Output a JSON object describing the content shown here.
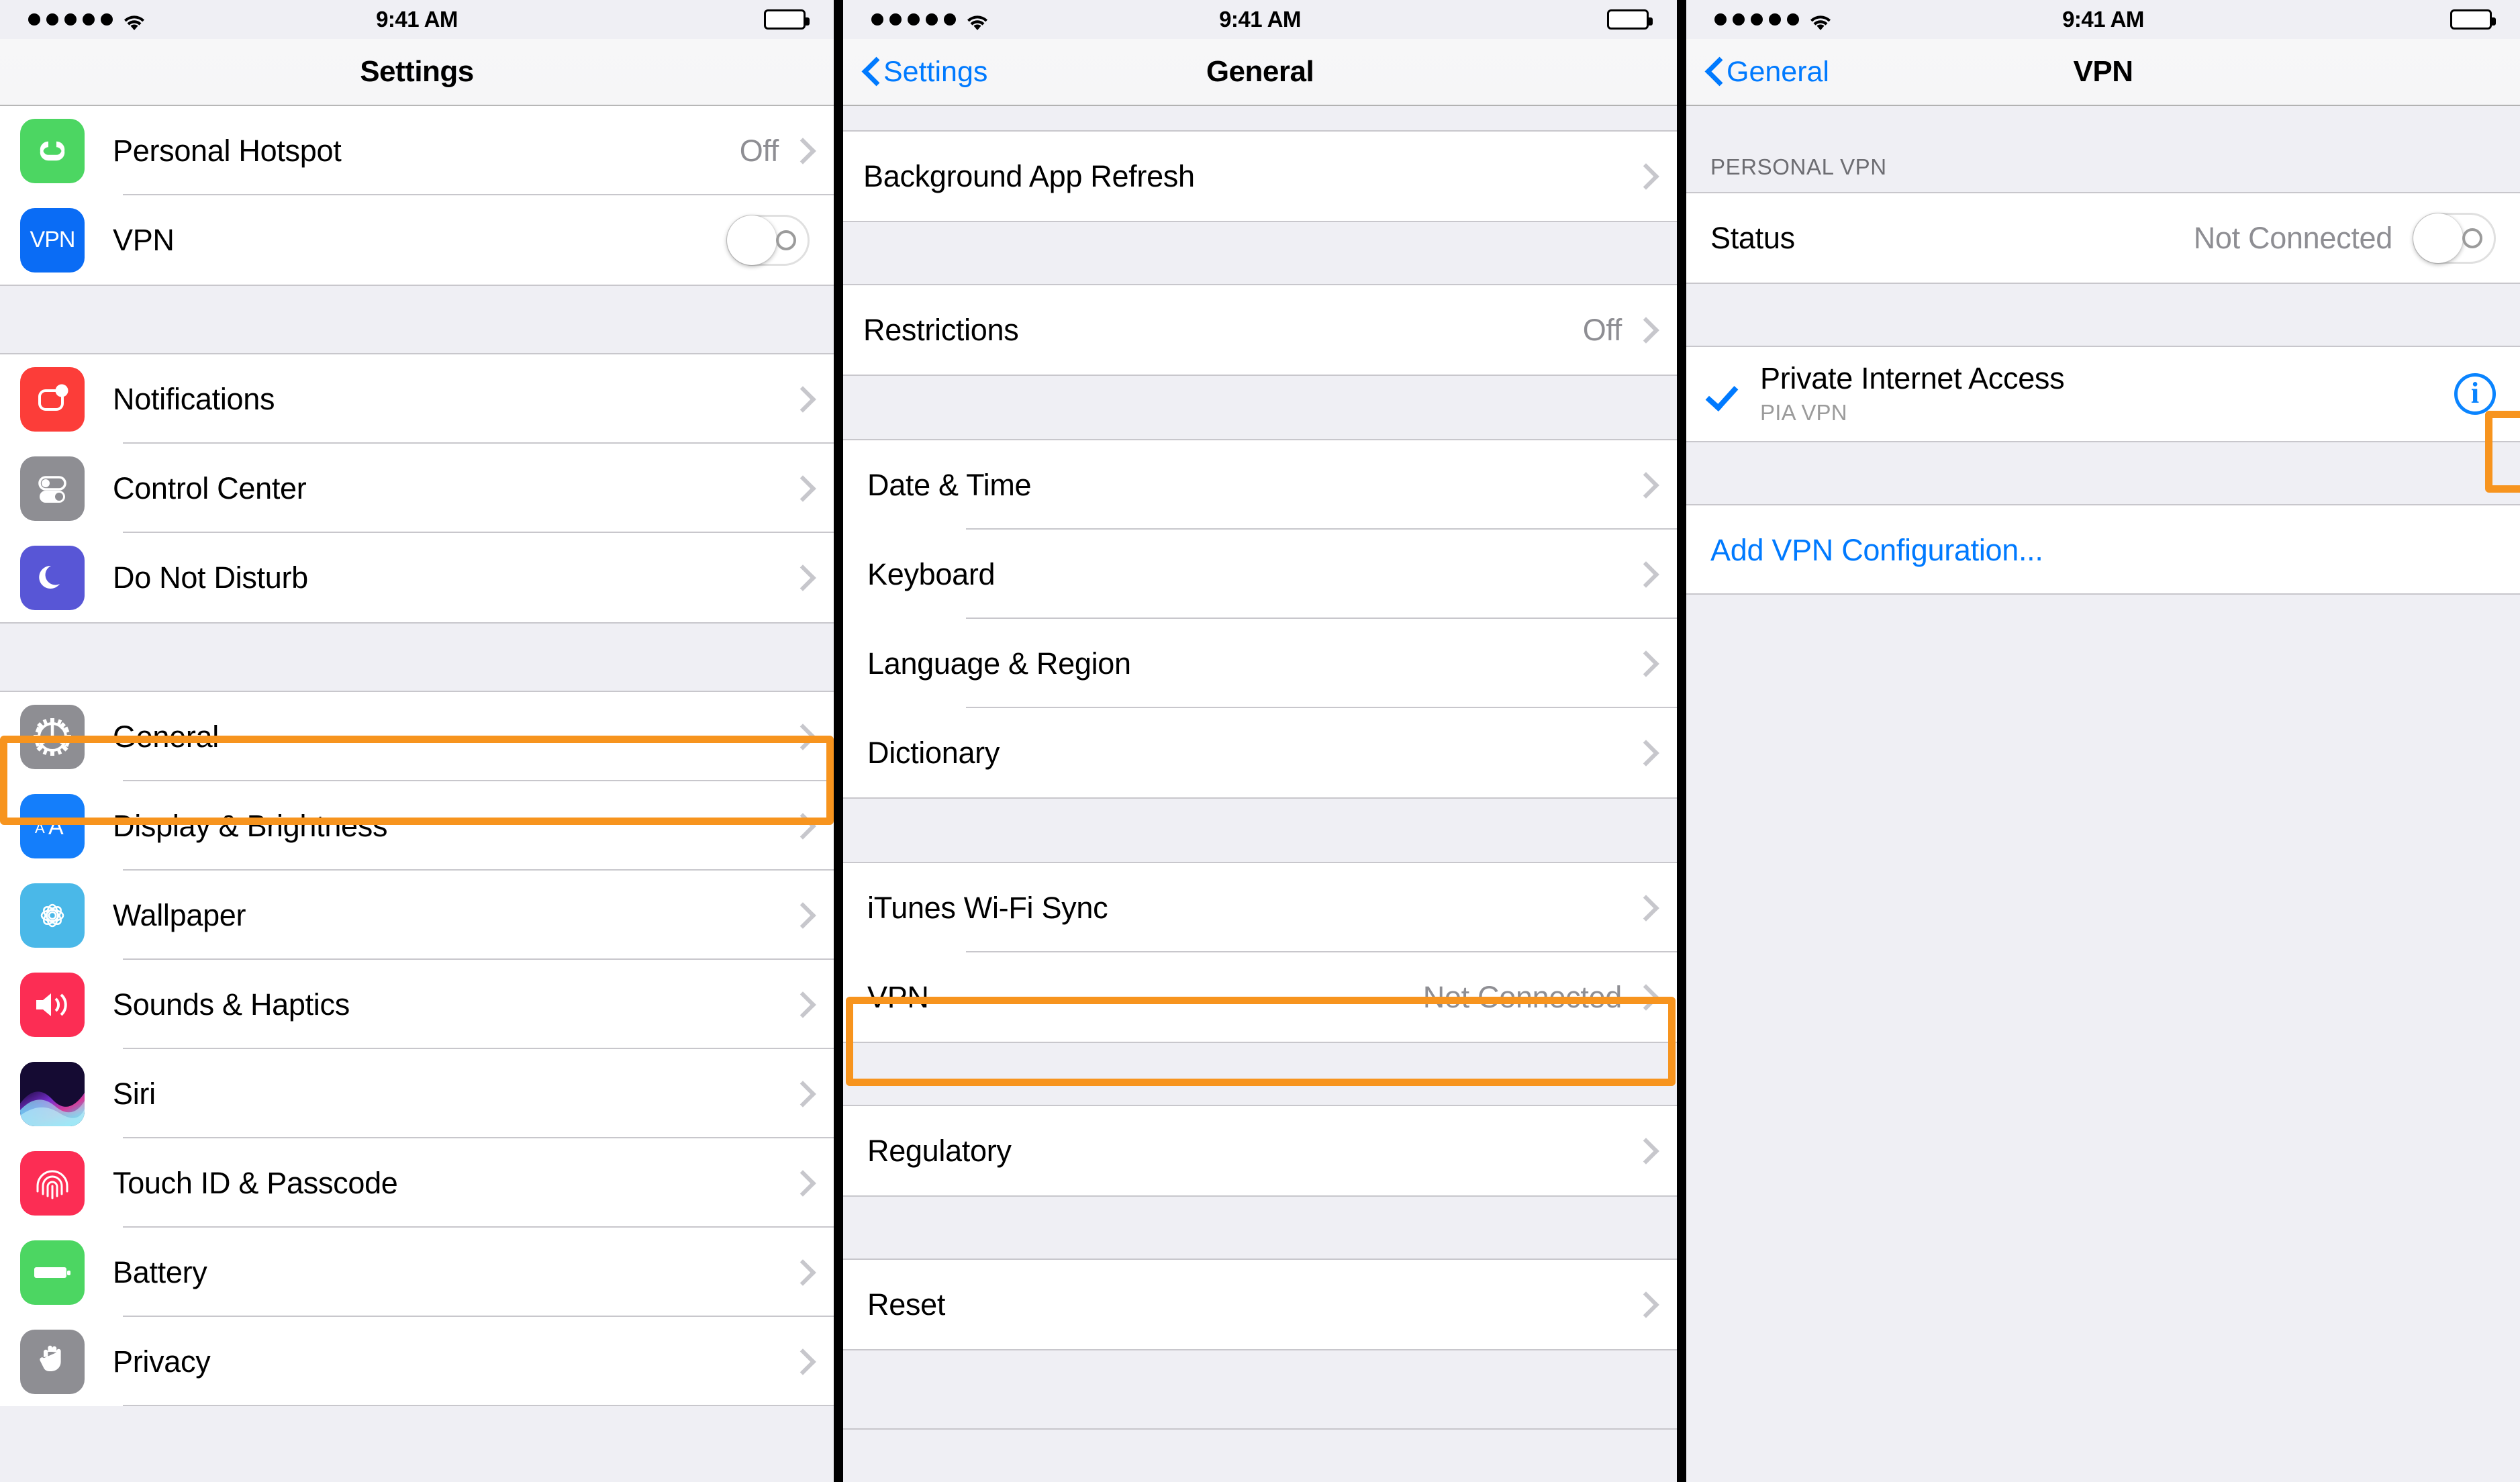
{
  "theme": {
    "accent_blue": "#007AFF",
    "highlight_orange": "#F7941E",
    "separator": "#C8C7CC",
    "group_bg": "#EFEFF4",
    "secondary_text": "#8E8E93"
  },
  "status_bar": {
    "time": "9:41 AM",
    "signal_dots": 5,
    "wifi_icon": "wifi-icon",
    "battery_icon": "battery-full-icon"
  },
  "panel1": {
    "nav": {
      "title": "Settings",
      "back_label": null
    },
    "groups": [
      {
        "rows": [
          {
            "label": "Personal Hotspot",
            "value": "Off",
            "icon": "personal-hotspot-icon",
            "accessory": "chevron"
          },
          {
            "label": "VPN",
            "value": "",
            "icon": "vpn-icon",
            "accessory": "toggle-off"
          }
        ]
      },
      {
        "rows": [
          {
            "label": "Notifications",
            "value": "",
            "icon": "notifications-icon",
            "accessory": "chevron"
          },
          {
            "label": "Control Center",
            "value": "",
            "icon": "control-center-icon",
            "accessory": "chevron"
          },
          {
            "label": "Do Not Disturb",
            "value": "",
            "icon": "do-not-disturb-icon",
            "accessory": "chevron"
          }
        ]
      },
      {
        "rows": [
          {
            "label": "General",
            "value": "",
            "icon": "general-gear-icon",
            "accessory": "chevron",
            "highlighted": true
          },
          {
            "label": "Display & Brightness",
            "value": "",
            "icon": "display-brightness-icon",
            "accessory": "chevron"
          },
          {
            "label": "Wallpaper",
            "value": "",
            "icon": "wallpaper-icon",
            "accessory": "chevron"
          },
          {
            "label": "Sounds & Haptics",
            "value": "",
            "icon": "sounds-haptics-icon",
            "accessory": "chevron"
          },
          {
            "label": "Siri",
            "value": "",
            "icon": "siri-icon",
            "accessory": "chevron"
          },
          {
            "label": "Touch ID & Passcode",
            "value": "",
            "icon": "touch-id-icon",
            "accessory": "chevron"
          },
          {
            "label": "Battery",
            "value": "",
            "icon": "battery-icon",
            "accessory": "chevron"
          },
          {
            "label": "Privacy",
            "value": "",
            "icon": "privacy-hand-icon",
            "accessory": "chevron"
          }
        ]
      }
    ]
  },
  "panel2": {
    "nav": {
      "title": "General",
      "back_label": "Settings"
    },
    "groups": [
      {
        "rows": [
          {
            "label": "Background App Refresh",
            "value": "",
            "accessory": "chevron"
          }
        ]
      },
      {
        "rows": [
          {
            "label": "Restrictions",
            "value": "Off",
            "accessory": "chevron"
          }
        ]
      },
      {
        "rows": [
          {
            "label": "Date & Time",
            "value": "",
            "accessory": "chevron"
          },
          {
            "label": "Keyboard",
            "value": "",
            "accessory": "chevron"
          },
          {
            "label": "Language & Region",
            "value": "",
            "accessory": "chevron"
          },
          {
            "label": "Dictionary",
            "value": "",
            "accessory": "chevron"
          }
        ]
      },
      {
        "rows": [
          {
            "label": "iTunes Wi-Fi Sync",
            "value": "",
            "accessory": "chevron"
          },
          {
            "label": "VPN",
            "value": "Not Connected",
            "accessory": "chevron",
            "highlighted": true
          }
        ]
      },
      {
        "rows": [
          {
            "label": "Regulatory",
            "value": "",
            "accessory": "chevron"
          }
        ]
      },
      {
        "rows": [
          {
            "label": "Reset",
            "value": "",
            "accessory": "chevron"
          }
        ]
      }
    ]
  },
  "panel3": {
    "nav": {
      "title": "VPN",
      "back_label": "General"
    },
    "section_header": "PERSONAL VPN",
    "status_row": {
      "label": "Status",
      "value": "Not Connected",
      "accessory": "toggle-off"
    },
    "config_row": {
      "title": "Private Internet Access",
      "subtitle": "PIA VPN",
      "selected": true,
      "check_icon": "checkmark-icon",
      "info_icon": "info-circle-icon",
      "info_highlighted": true
    },
    "add_row": {
      "label": "Add VPN Configuration..."
    }
  }
}
